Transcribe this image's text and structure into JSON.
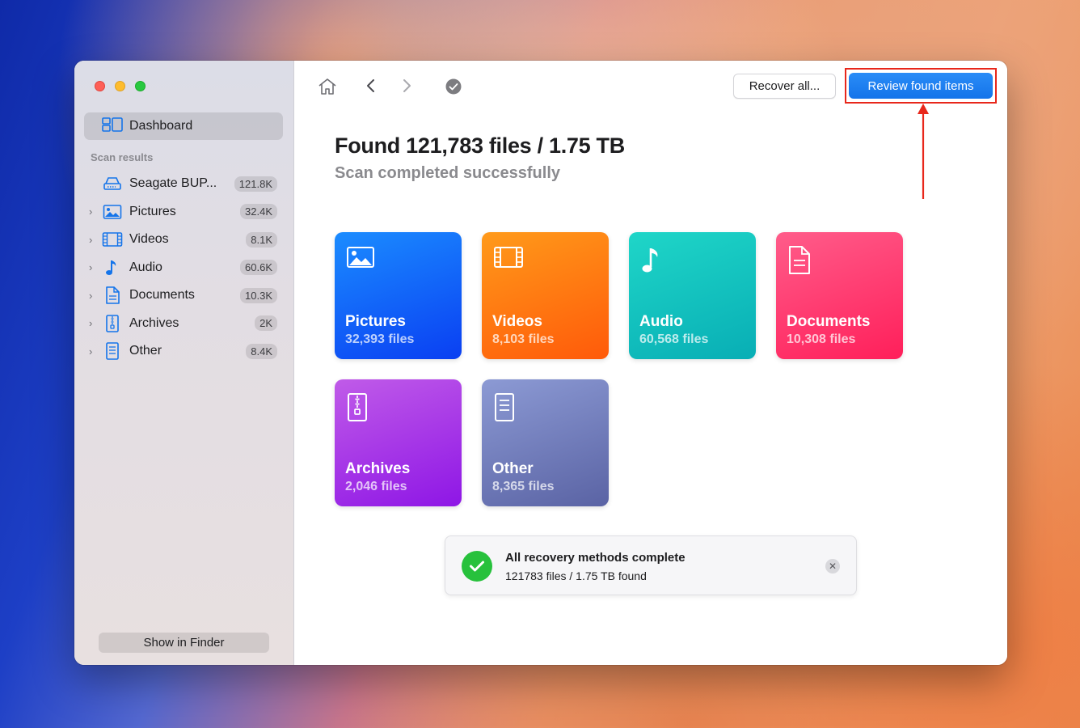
{
  "window": {
    "traffic_lights": [
      "close",
      "minimize",
      "zoom"
    ]
  },
  "sidebar": {
    "dashboard_label": "Dashboard",
    "section_title": "Scan results",
    "items": [
      {
        "label": "Seagate BUP...",
        "count": "121.8K",
        "icon": "drive-icon",
        "expandable": false
      },
      {
        "label": "Pictures",
        "count": "32.4K",
        "icon": "picture-icon",
        "expandable": true
      },
      {
        "label": "Videos",
        "count": "8.1K",
        "icon": "film-icon",
        "expandable": true
      },
      {
        "label": "Audio",
        "count": "60.6K",
        "icon": "music-note-icon",
        "expandable": true
      },
      {
        "label": "Documents",
        "count": "10.3K",
        "icon": "document-icon",
        "expandable": true
      },
      {
        "label": "Archives",
        "count": "2K",
        "icon": "archive-icon",
        "expandable": true
      },
      {
        "label": "Other",
        "count": "8.4K",
        "icon": "other-file-icon",
        "expandable": true
      }
    ],
    "show_in_finder_label": "Show in Finder"
  },
  "toolbar": {
    "recover_all_label": "Recover all...",
    "review_found_label": "Review found items"
  },
  "main": {
    "title": "Found 121,783 files / 1.75 TB",
    "subtitle": "Scan completed successfully",
    "tiles": [
      {
        "name": "Pictures",
        "count": "32,393 files",
        "icon": "picture-icon",
        "color": "#1b6cff"
      },
      {
        "name": "Videos",
        "count": "8,103 files",
        "icon": "film-icon",
        "color": "#ff7a12"
      },
      {
        "name": "Audio",
        "count": "60,568 files",
        "icon": "music-note-icon",
        "color": "#12c4c0"
      },
      {
        "name": "Documents",
        "count": "10,308 files",
        "icon": "document-icon",
        "color": "#ff3d70"
      },
      {
        "name": "Archives",
        "count": "2,046 files",
        "icon": "archive-icon",
        "color": "#a734e8"
      },
      {
        "name": "Other",
        "count": "8,365 files",
        "icon": "other-file-icon",
        "color": "#737ebd"
      }
    ]
  },
  "toast": {
    "title": "All recovery methods complete",
    "subtitle": "121783 files / 1.75 TB found"
  },
  "colors": {
    "accent": "#1474ea",
    "annotation": "#e8271b",
    "success": "#27c13c"
  }
}
